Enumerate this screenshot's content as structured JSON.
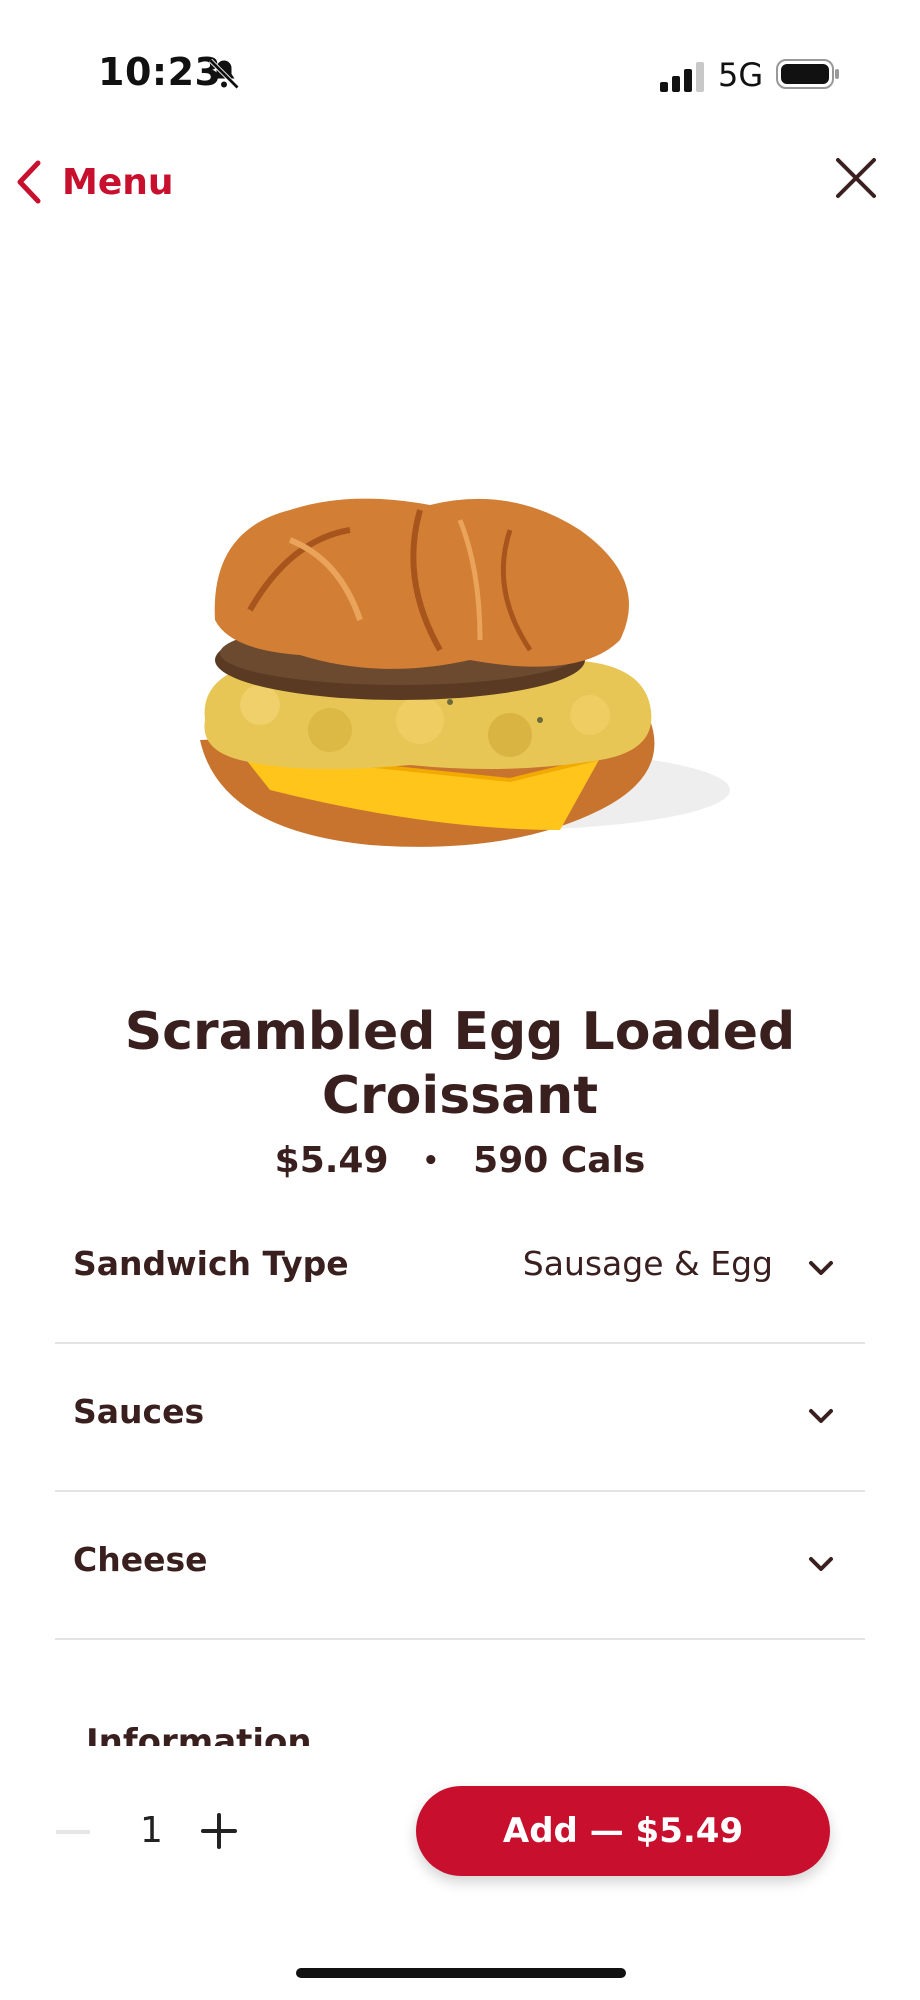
{
  "status_bar": {
    "time": "10:23",
    "network": "5G"
  },
  "nav": {
    "back_label": "Menu"
  },
  "product": {
    "title": "Scrambled Egg Loaded Croissant",
    "price": "$5.49",
    "separator": "•",
    "calories": "590 Cals"
  },
  "options": [
    {
      "label": "Sandwich Type",
      "value": "Sausage & Egg"
    },
    {
      "label": "Sauces",
      "value": ""
    },
    {
      "label": "Cheese",
      "value": ""
    }
  ],
  "information_label": "Information",
  "quantity": "1",
  "add_button_label": "Add — $5.49",
  "colors": {
    "brand_red": "#c8102e",
    "text_brown": "#3a1f1f",
    "divider": "#e3e3e3"
  }
}
